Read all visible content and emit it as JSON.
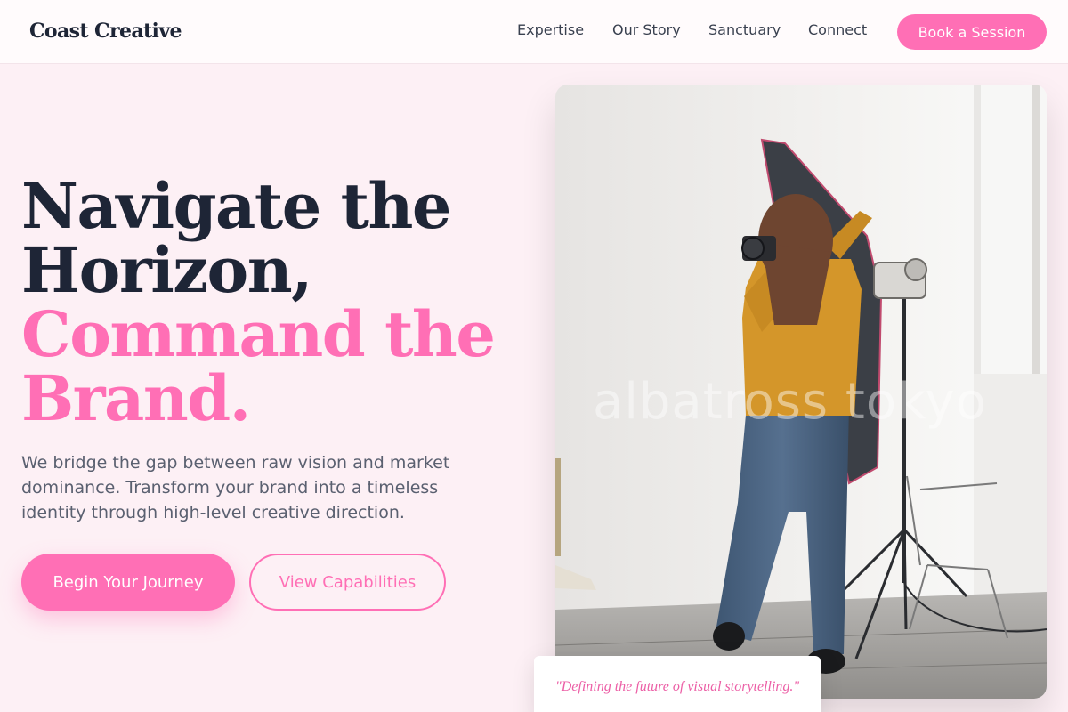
{
  "brand": {
    "logo": "Coast Creative"
  },
  "nav": {
    "links": [
      "Expertise",
      "Our Story",
      "Sanctuary",
      "Connect"
    ],
    "cta": "Book a Session"
  },
  "hero": {
    "title_lines": [
      "Navigate the",
      "Horizon,",
      "Command the",
      "Brand."
    ],
    "subtitle": "We bridge the gap between raw vision and market dominance. Transform your brand into a timeless identity through high-level creative direction.",
    "primary_button": "Begin Your Journey",
    "secondary_button": "View Capabilities",
    "image_watermark": "albatross tokyo",
    "quote": "\"Defining the future of visual storytelling.\""
  },
  "colors": {
    "accent": "#ff6fb5",
    "heading_dark": "#1e2536",
    "page_background": "#fdf0f5",
    "body_text": "#5a6070"
  },
  "icons": []
}
